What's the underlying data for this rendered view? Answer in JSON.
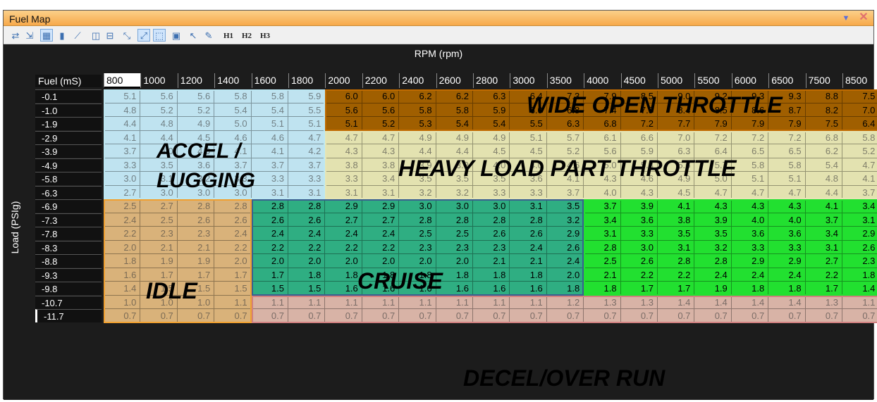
{
  "window": {
    "title": "Fuel Map",
    "minimize_icon": "triangle-down-icon",
    "close_icon": "close-x-icon"
  },
  "toolbar": {
    "tools": [
      {
        "name": "refresh-icon",
        "glyph": "⇄",
        "active": false
      },
      {
        "name": "export-icon",
        "glyph": "⇲",
        "active": false
      },
      {
        "name": "table-view-icon",
        "glyph": "▦",
        "active": true
      },
      {
        "name": "bar-chart-icon",
        "glyph": "▮",
        "active": false
      },
      {
        "name": "interpolate-icon",
        "glyph": "⟋",
        "active": false
      },
      {
        "name": "split-vertical-icon",
        "glyph": "◫",
        "active": false
      },
      {
        "name": "split-horizontal-icon",
        "glyph": "⊟",
        "active": false
      },
      {
        "name": "shrink-icon",
        "glyph": "⤡",
        "active": false
      },
      {
        "name": "fit-icon",
        "glyph": "⤢",
        "active": true
      },
      {
        "name": "select-all-icon",
        "glyph": "⬚",
        "active": true
      },
      {
        "name": "select-range-icon",
        "glyph": "▣",
        "active": false
      },
      {
        "name": "pointer-icon",
        "glyph": "↖",
        "active": false
      },
      {
        "name": "pencil-icon",
        "glyph": "✎",
        "active": false
      },
      {
        "name": "h1-icon",
        "glyph": "H1",
        "active": false
      },
      {
        "name": "h2-icon",
        "glyph": "H2",
        "active": false
      },
      {
        "name": "h3-icon",
        "glyph": "H3",
        "active": false
      }
    ]
  },
  "table": {
    "x_axis_label": "RPM (rpm)",
    "y_axis_label": "Load (PSIg)",
    "corner_label": "Fuel (mS)",
    "columns": [
      "800",
      "1000",
      "1200",
      "1400",
      "1600",
      "1800",
      "2000",
      "2200",
      "2400",
      "2600",
      "2800",
      "3000",
      "3500",
      "4000",
      "4500",
      "5000",
      "5500",
      "6000",
      "6500",
      "7500",
      "8500"
    ],
    "selected_column": 0,
    "rows": [
      "-0.1",
      "-1.0",
      "-1.9",
      "-2.9",
      "-3.9",
      "-4.9",
      "-5.8",
      "-6.3",
      "-6.9",
      "-7.3",
      "-7.8",
      "-8.3",
      "-8.8",
      "-9.3",
      "-9.8",
      "-10.7",
      "-11.7"
    ],
    "selected_row": 16,
    "values": [
      [
        "5.1",
        "5.6",
        "5.6",
        "5.8",
        "5.8",
        "5.9",
        "6.0",
        "6.0",
        "6.2",
        "6.2",
        "6.3",
        "6.4",
        "7.3",
        "7.9",
        "8.5",
        "9.0",
        "9.2",
        "9.3",
        "9.3",
        "8.8",
        "7.5"
      ],
      [
        "4.8",
        "5.2",
        "5.2",
        "5.4",
        "5.4",
        "5.5",
        "5.6",
        "5.6",
        "5.8",
        "5.8",
        "5.9",
        "6.0",
        "6.8",
        "7.4",
        "7.9",
        "8.4",
        "8.5",
        "8.6",
        "8.7",
        "8.2",
        "7.0"
      ],
      [
        "4.4",
        "4.8",
        "4.9",
        "5.0",
        "5.1",
        "5.1",
        "5.1",
        "5.2",
        "5.3",
        "5.4",
        "5.4",
        "5.5",
        "6.3",
        "6.8",
        "7.2",
        "7.7",
        "7.9",
        "7.9",
        "7.9",
        "7.5",
        "6.4"
      ],
      [
        "4.1",
        "4.4",
        "4.5",
        "4.6",
        "4.6",
        "4.7",
        "4.7",
        "4.7",
        "4.9",
        "4.9",
        "4.9",
        "5.1",
        "5.7",
        "6.1",
        "6.6",
        "7.0",
        "7.2",
        "7.2",
        "7.2",
        "6.8",
        "5.8"
      ],
      [
        "3.7",
        "4.0",
        "4.0",
        "4.1",
        "4.1",
        "4.2",
        "4.3",
        "4.3",
        "4.4",
        "4.4",
        "4.5",
        "4.5",
        "5.2",
        "5.6",
        "5.9",
        "6.3",
        "6.4",
        "6.5",
        "6.5",
        "6.2",
        "5.2"
      ],
      [
        "3.3",
        "3.5",
        "3.6",
        "3.7",
        "3.7",
        "3.7",
        "3.8",
        "3.8",
        "3.9",
        "3.9",
        "4.0",
        "4.0",
        "4.6",
        "5.0",
        "5.3",
        "5.6",
        "5.7",
        "5.8",
        "5.8",
        "5.4",
        "4.7"
      ],
      [
        "3.0",
        "3.1",
        "3.2",
        "3.3",
        "3.3",
        "3.3",
        "3.3",
        "3.4",
        "3.5",
        "3.5",
        "3.5",
        "3.6",
        "4.1",
        "4.3",
        "4.6",
        "4.9",
        "5.0",
        "5.1",
        "5.1",
        "4.8",
        "4.1"
      ],
      [
        "2.7",
        "3.0",
        "3.0",
        "3.0",
        "3.1",
        "3.1",
        "3.1",
        "3.1",
        "3.2",
        "3.2",
        "3.3",
        "3.3",
        "3.7",
        "4.0",
        "4.3",
        "4.5",
        "4.7",
        "4.7",
        "4.7",
        "4.4",
        "3.7"
      ],
      [
        "2.5",
        "2.7",
        "2.8",
        "2.8",
        "2.8",
        "2.8",
        "2.9",
        "2.9",
        "3.0",
        "3.0",
        "3.0",
        "3.1",
        "3.5",
        "3.7",
        "3.9",
        "4.1",
        "4.3",
        "4.3",
        "4.3",
        "4.1",
        "3.4"
      ],
      [
        "2.4",
        "2.5",
        "2.6",
        "2.6",
        "2.6",
        "2.6",
        "2.7",
        "2.7",
        "2.8",
        "2.8",
        "2.8",
        "2.8",
        "3.2",
        "3.4",
        "3.6",
        "3.8",
        "3.9",
        "4.0",
        "4.0",
        "3.7",
        "3.1"
      ],
      [
        "2.2",
        "2.3",
        "2.3",
        "2.4",
        "2.4",
        "2.4",
        "2.4",
        "2.4",
        "2.5",
        "2.5",
        "2.6",
        "2.6",
        "2.9",
        "3.1",
        "3.3",
        "3.5",
        "3.5",
        "3.6",
        "3.6",
        "3.4",
        "2.9"
      ],
      [
        "2.0",
        "2.1",
        "2.1",
        "2.2",
        "2.2",
        "2.2",
        "2.2",
        "2.2",
        "2.3",
        "2.3",
        "2.3",
        "2.4",
        "2.6",
        "2.8",
        "3.0",
        "3.1",
        "3.2",
        "3.3",
        "3.3",
        "3.1",
        "2.6"
      ],
      [
        "1.8",
        "1.9",
        "1.9",
        "2.0",
        "2.0",
        "2.0",
        "2.0",
        "2.0",
        "2.0",
        "2.0",
        "2.1",
        "2.1",
        "2.4",
        "2.5",
        "2.6",
        "2.8",
        "2.8",
        "2.9",
        "2.9",
        "2.7",
        "2.3"
      ],
      [
        "1.6",
        "1.7",
        "1.7",
        "1.7",
        "1.7",
        "1.8",
        "1.8",
        "1.8",
        "1.8",
        "1.8",
        "1.8",
        "1.8",
        "2.0",
        "2.1",
        "2.2",
        "2.2",
        "2.4",
        "2.4",
        "2.4",
        "2.2",
        "1.8"
      ],
      [
        "1.4",
        "1.5",
        "1.5",
        "1.5",
        "1.5",
        "1.5",
        "1.6",
        "1.6",
        "1.6",
        "1.6",
        "1.6",
        "1.6",
        "1.8",
        "1.8",
        "1.7",
        "1.7",
        "1.9",
        "1.8",
        "1.8",
        "1.7",
        "1.4"
      ],
      [
        "1.0",
        "1.0",
        "1.0",
        "1.1",
        "1.1",
        "1.1",
        "1.1",
        "1.1",
        "1.1",
        "1.1",
        "1.1",
        "1.1",
        "1.2",
        "1.3",
        "1.3",
        "1.4",
        "1.4",
        "1.4",
        "1.4",
        "1.3",
        "1.1"
      ],
      [
        "0.7",
        "0.7",
        "0.7",
        "0.7",
        "0.7",
        "0.7",
        "0.7",
        "0.7",
        "0.7",
        "0.7",
        "0.7",
        "0.7",
        "0.7",
        "0.7",
        "0.7",
        "0.7",
        "0.7",
        "0.7",
        "0.7",
        "0.7",
        "0.7"
      ]
    ]
  },
  "zones": [
    {
      "id": "wot",
      "label": "WIDE OPEN THROTTLE",
      "color": "#a05f00",
      "rows": [
        0,
        2
      ],
      "cols": [
        6,
        20
      ]
    },
    {
      "id": "accel",
      "label_lines": [
        "ACCEL /",
        "LUGGING"
      ],
      "color": "#bfe3f0",
      "rows": [
        0,
        7
      ],
      "cols": [
        0,
        5
      ]
    },
    {
      "id": "heavy",
      "label": "HEAVY LOAD PART THROTTLE",
      "color": "#e3e2b0",
      "rows": [
        3,
        7
      ],
      "cols": [
        6,
        20
      ]
    },
    {
      "id": "idle",
      "label": "IDLE",
      "color": "#d9b27a",
      "rows": [
        8,
        16
      ],
      "cols": [
        0,
        3
      ]
    },
    {
      "id": "cruise",
      "label": "CRUISE",
      "color": "#2fae82",
      "rows": [
        8,
        14
      ],
      "cols": [
        4,
        12
      ]
    },
    {
      "id": "high",
      "label": "",
      "color": "#22e030",
      "rows": [
        8,
        14
      ],
      "cols": [
        13,
        20
      ]
    },
    {
      "id": "decel",
      "label": "DECEL/OVER RUN",
      "color": "#d8b3a6",
      "rows": [
        15,
        16
      ],
      "cols": [
        4,
        20
      ]
    }
  ]
}
